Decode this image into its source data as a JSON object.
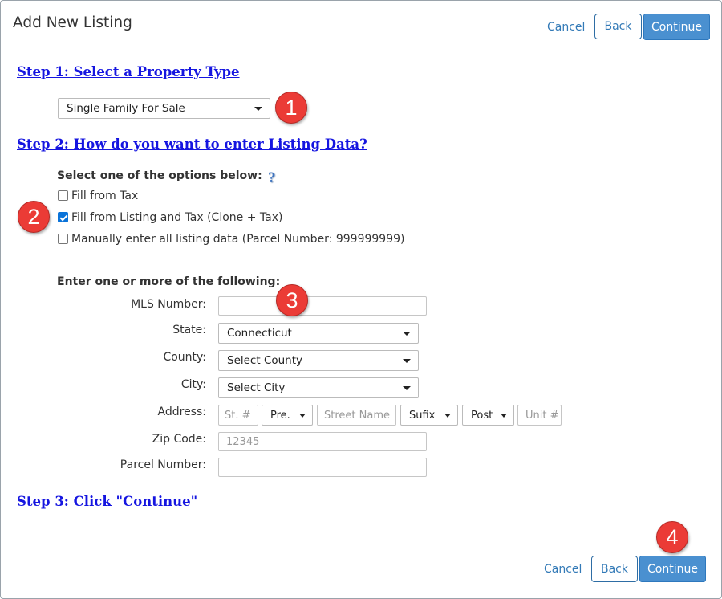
{
  "dialog": {
    "title": "Add New Listing"
  },
  "header_actions": {
    "cancel_label": "Cancel",
    "back_label": "Back",
    "continue_label": "Continue"
  },
  "footer_actions": {
    "cancel_label": "Cancel",
    "back_label": "Back",
    "continue_label": "Continue"
  },
  "step1": {
    "heading": "Step 1: Select a Property Type",
    "property_type": "Single Family For Sale"
  },
  "step2": {
    "heading": "Step 2: How do you want to enter Listing Data?",
    "prompt": "Select one of the options below:",
    "help_glyph": "?",
    "options": [
      {
        "label": "Fill from Tax",
        "checked": false
      },
      {
        "label": "Fill from Listing and Tax (Clone + Tax)",
        "checked": true
      },
      {
        "label": "Manually enter all listing data (Parcel Number: 999999999)",
        "checked": false
      }
    ]
  },
  "lookup": {
    "heading": "Enter one or more of the following:",
    "mls_label": "MLS Number:",
    "mls_value": "",
    "state_label": "State:",
    "state_value": "Connecticut",
    "county_label": "County:",
    "county_value": "Select County",
    "city_label": "City:",
    "city_value": "Select City",
    "address_label": "Address:",
    "address": {
      "street_no_placeholder": "St. #",
      "prefix_value": "Pre.",
      "street_name_placeholder": "Street Name",
      "suffix_value": "Sufix",
      "post_value": "Post",
      "unit_placeholder": "Unit #"
    },
    "zip_label": "Zip Code:",
    "zip_placeholder": "12345",
    "parcel_label": "Parcel Number:",
    "parcel_value": ""
  },
  "step3": {
    "heading": "Step 3: Click \"Continue\""
  },
  "callouts": {
    "one": "1",
    "two": "2",
    "three": "3",
    "four": "4"
  },
  "colors": {
    "badge": "#eb3b36",
    "link_blue": "#1515e0",
    "primary_button": "#4a90d0",
    "button_text_blue": "#337ab7"
  }
}
